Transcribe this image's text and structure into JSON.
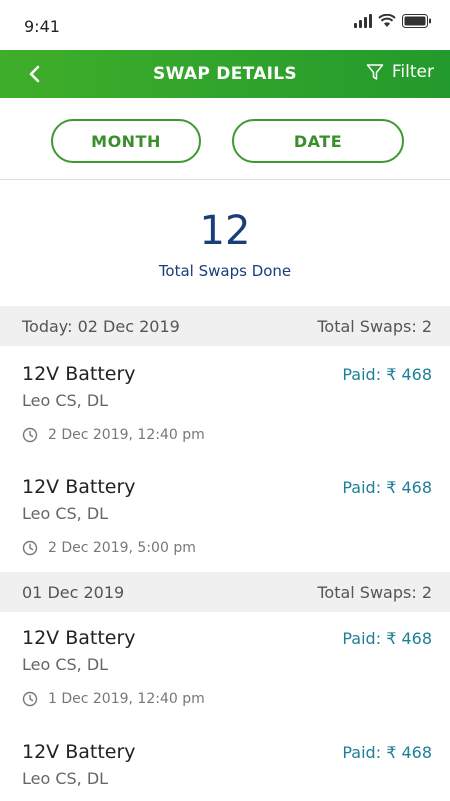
{
  "status_bar": {
    "time": "9:41"
  },
  "header": {
    "title": "SWAP DETAILS",
    "filter_label": "Filter"
  },
  "toggles": {
    "month": "MONTH",
    "date": "DATE"
  },
  "summary": {
    "count": "12",
    "label": "Total Swaps Done"
  },
  "groups": [
    {
      "date": "Today: 02 Dec 2019",
      "total": "Total Swaps: 2",
      "items": [
        {
          "title": "12V Battery",
          "amount": "Paid: ₹ 468",
          "location": "Leo CS, DL",
          "time": "2 Dec 2019, 12:40 pm"
        },
        {
          "title": "12V Battery",
          "amount": "Paid: ₹ 468",
          "location": "Leo CS, DL",
          "time": "2 Dec 2019, 5:00 pm"
        }
      ]
    },
    {
      "date": "01 Dec 2019",
      "total": "Total Swaps: 2",
      "items": [
        {
          "title": "12V Battery",
          "amount": "Paid: ₹ 468",
          "location": "Leo CS, DL",
          "time": "1 Dec 2019, 12:40 pm"
        },
        {
          "title": "12V Battery",
          "amount": "Paid: ₹ 468",
          "location": "Leo CS, DL",
          "time": ""
        }
      ]
    }
  ],
  "colors": {
    "brand_green": "#3fae2a",
    "title_blue": "#1b3d7a",
    "amount_teal": "#1f7f98"
  },
  "icons": [
    "signal-icon",
    "wifi-icon",
    "battery-icon",
    "back-arrow-icon",
    "filter-icon",
    "clock-icon"
  ]
}
